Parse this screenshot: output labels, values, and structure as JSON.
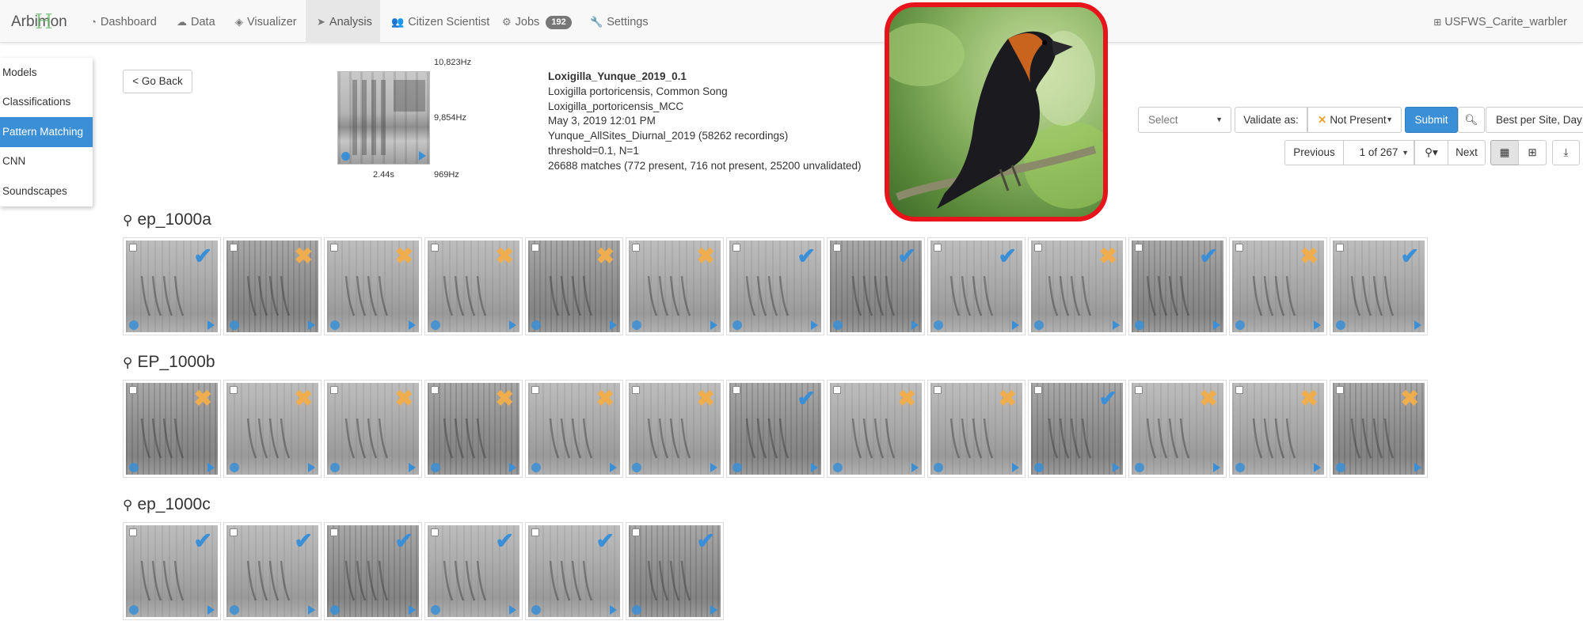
{
  "app": {
    "brand": "Arbimon",
    "brand_mark": "H"
  },
  "nav": {
    "items": [
      {
        "label": "Dashboard",
        "icon": "dashboard-icon"
      },
      {
        "label": "Data",
        "icon": "cloud-icon"
      },
      {
        "label": "Visualizer",
        "icon": "visualizer-icon"
      },
      {
        "label": "Analysis",
        "icon": "paper-plane-icon",
        "active": true
      },
      {
        "label": "Citizen Scientist",
        "icon": "users-icon"
      },
      {
        "label": "Jobs",
        "icon": "gears-icon"
      },
      {
        "label": "Settings",
        "icon": "wrench-icon"
      }
    ],
    "jobs_badge": "192",
    "user": "USFWS_Carite_warbler"
  },
  "side_menu": {
    "items": [
      "Models",
      "Classifications",
      "Pattern Matching",
      "CNN",
      "Soundscapes"
    ],
    "active": "Pattern Matching"
  },
  "header": {
    "go_back": "< Go Back",
    "freq_top": "10,823Hz",
    "freq_mid": "9,854Hz",
    "freq_bottom": "969Hz",
    "duration": "2.44s",
    "info": {
      "title": "Loxigilla_Yunque_2019_0.1",
      "species": "Loxigilla portoricensis, Common Song",
      "template": "Loxigilla_portoricensis_MCC",
      "date": "May 3, 2019 12:01 PM",
      "playlist": "Yunque_AllSites_Diurnal_2019 (58262 recordings)",
      "params": "threshold=0.1, N=1",
      "matches": "26688 matches (772 present, 716 not present, 25200 unvalidated)"
    }
  },
  "controls": {
    "select_placeholder": "Select",
    "validate_label": "Validate as:",
    "validate_value": "Not Present",
    "submit": "Submit",
    "sort_value": "Best per Site, Day",
    "prev": "Previous",
    "page": "1 of 267",
    "next": "Next"
  },
  "sites": [
    {
      "name": "ep_1000a",
      "tiles": [
        "present",
        "absent",
        "absent",
        "absent",
        "absent",
        "absent",
        "present",
        "present",
        "present",
        "absent",
        "present",
        "absent",
        "present"
      ]
    },
    {
      "name": "EP_1000b",
      "tiles": [
        "absent",
        "absent",
        "absent",
        "absent",
        "absent",
        "absent",
        "present",
        "absent",
        "absent",
        "present",
        "absent",
        "absent",
        "absent"
      ]
    },
    {
      "name": "ep_1000c",
      "tiles": [
        "present",
        "present",
        "present",
        "present",
        "present",
        "present"
      ]
    }
  ],
  "colors": {
    "accent": "#3b8fd6",
    "present": "#3b8fd6",
    "absent": "#f0ad4e",
    "highlight_frame": "#e8141c"
  }
}
